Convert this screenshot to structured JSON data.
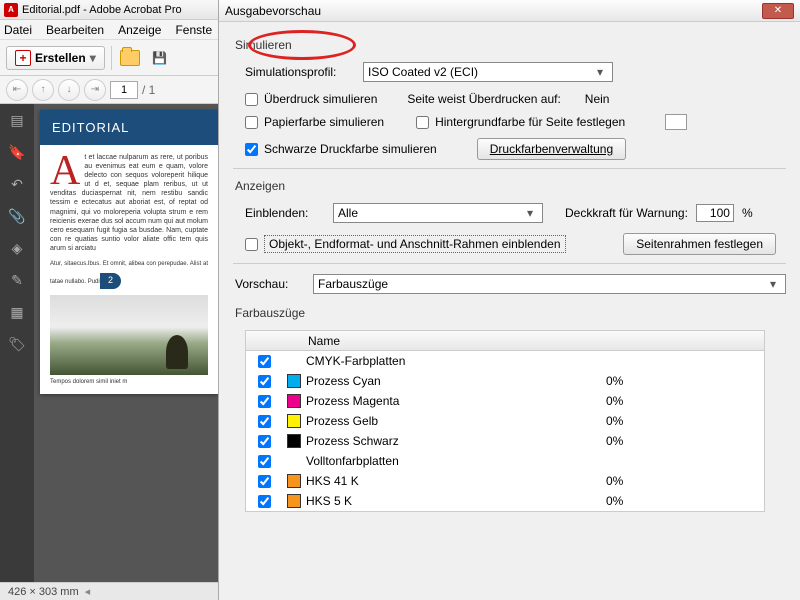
{
  "app": {
    "title": "Editorial.pdf - Adobe Acrobat Pro"
  },
  "menu": {
    "file": "Datei",
    "edit": "Bearbeiten",
    "view": "Anzeige",
    "window": "Fenste"
  },
  "toolbar": {
    "create": "Erstellen"
  },
  "nav": {
    "page": "1",
    "total": "/  1"
  },
  "doc": {
    "heading": "EDITORIAL",
    "dropcap": "A",
    "body1": "t et laccae nulparum as rere, ut poribus au evenimus eat eum e quam, volore delecto con sequos voloreperit hilique ut d et, sequae plam reribus, ut ut venditas duciaspernat nit, nem restibu sandic tessim e ectecatus aut aboriat est, of reptat od magnimi, qui vo moloreperia volupta strum e rem reicienis exerae dus sol accum num qui aut molum cero esequam fugit fugia sa busdae. Nam, cuptate con re quatias suntio volor aliate offic tem quis arum si arciatu",
    "body2": "Atur, sitaecus.Ibus. Et omnit, alibea con perepudae. Alist at tatae nullabo. Puditat.",
    "page_num": "2",
    "caption": "Tempos dolorem simil iniet m"
  },
  "status": {
    "dims": "426 × 303 mm"
  },
  "dialog": {
    "title": "Ausgabevorschau",
    "sections": {
      "simulate": "Simulieren",
      "show": "Anzeigen",
      "separations": "Farbauszüge"
    },
    "sim": {
      "profile_label": "Simulationsprofil:",
      "profile_value": "ISO Coated v2 (ECI)",
      "overprint": "Überdruck simulieren",
      "page_overprint_label": "Seite weist Überdrucken auf:",
      "page_overprint_value": "Nein",
      "papercolor": "Papierfarbe simulieren",
      "bgcolor": "Hintergrundfarbe für Seite festlegen",
      "blackink": "Schwarze Druckfarbe simulieren",
      "ink_manager_btn": "Druckfarbenverwaltung"
    },
    "show": {
      "show_label": "Einblenden:",
      "show_value": "Alle",
      "opacity_label": "Deckkraft für Warnung:",
      "opacity_value": "100",
      "percent": "%",
      "boxes_label": "Objekt-, Endformat- und Anschnitt-Rahmen einblenden",
      "pageboxes_btn": "Seitenrahmen festlegen"
    },
    "preview": {
      "label": "Vorschau:",
      "value": "Farbauszüge"
    },
    "table": {
      "col_name": "Name",
      "rows": [
        {
          "swatch": null,
          "name": "CMYK-Farbplatten",
          "pct": ""
        },
        {
          "swatch": "#00aeef",
          "name": "Prozess Cyan",
          "pct": "0%"
        },
        {
          "swatch": "#ec008c",
          "name": "Prozess Magenta",
          "pct": "0%"
        },
        {
          "swatch": "#fff200",
          "name": "Prozess Gelb",
          "pct": "0%"
        },
        {
          "swatch": "#000000",
          "name": "Prozess Schwarz",
          "pct": "0%"
        },
        {
          "swatch": null,
          "name": "Volltonfarbplatten",
          "pct": ""
        },
        {
          "swatch": "#f7941d",
          "name": "HKS 41 K",
          "pct": "0%"
        },
        {
          "swatch": "#f7941d",
          "name": "HKS 5 K",
          "pct": "0%"
        }
      ]
    }
  }
}
